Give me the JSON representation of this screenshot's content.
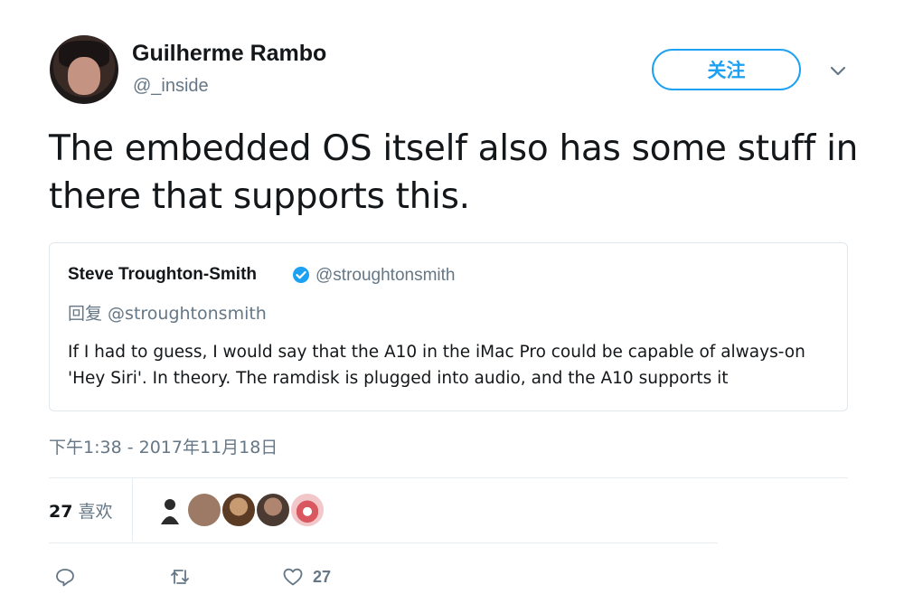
{
  "author": {
    "display_name": "Guilherme Rambo",
    "handle": "@_inside",
    "follow_label": "关注"
  },
  "tweet": {
    "text": "The embedded OS itself also has some stuff in there that supports this.",
    "timestamp": "下午1:38 - 2017年11月18日"
  },
  "quoted_tweet": {
    "display_name": "Steve Troughton-Smith",
    "handle": "@stroughtonsmith",
    "reply_to": "回复 @stroughtonsmith",
    "text": "If I had to guess, I would say that the A10 in the iMac Pro could be capable of always-on 'Hey Siri'. In theory. The ramdisk is plugged into audio, and the A10 supports it"
  },
  "stats": {
    "likes_count": "27",
    "likes_label": "喜欢"
  },
  "likers": [
    {
      "icon": "avatar-1",
      "color": "#2b2b2b"
    },
    {
      "icon": "avatar-2",
      "color": "#9c7a66"
    },
    {
      "icon": "avatar-3",
      "color": "#6b4a34"
    },
    {
      "icon": "avatar-4",
      "color": "#7a5a48"
    },
    {
      "icon": "avatar-5",
      "color": "#d9575f"
    }
  ],
  "actions": {
    "reply_icon": "reply-icon",
    "retweet_icon": "retweet-icon",
    "like_icon": "heart-icon",
    "like_count": "27"
  },
  "colors": {
    "accent": "#1da1f2",
    "secondary_text": "#657786",
    "border": "#e1e8ed"
  }
}
